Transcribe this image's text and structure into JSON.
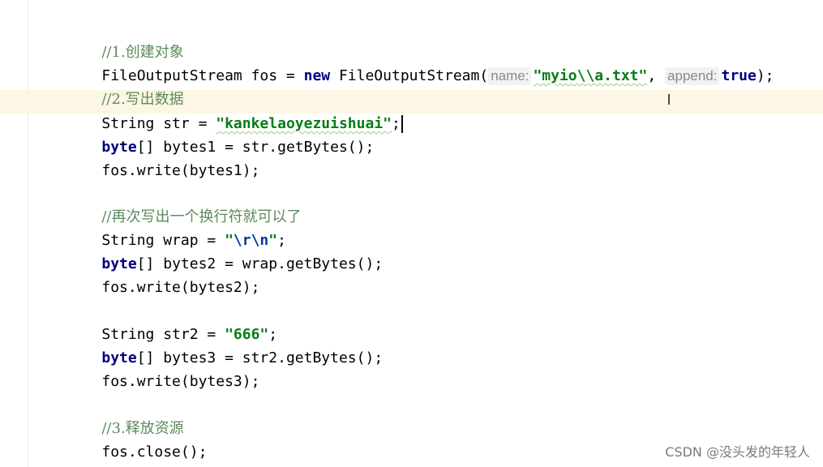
{
  "code": {
    "l1_comment": "//1.创建对象",
    "l2_type": "FileOutputStream fos = ",
    "l2_new": "new",
    "l2_ctor": " FileOutputStream(",
    "l2_hint_name": "name:",
    "l2_str": "\"myio\\\\a.txt\"",
    "l2_comma": ", ",
    "l2_hint_append": "append:",
    "l2_true": "true",
    "l2_end": ");",
    "l3_comment": "//2.写出数据",
    "l4_decl": "String str = ",
    "l4_str": "\"kankelaoyezuishuai\"",
    "l4_end": ";",
    "l5_byte": "byte",
    "l5_rest": "[] bytes1 = str.getBytes();",
    "l6": "fos.write(bytes1);",
    "l8_comment": "//再次写出一个换行符就可以了",
    "l9_decl": "String wrap = ",
    "l9_q1": "\"",
    "l9_esc": "\\r\\n",
    "l9_q2": "\"",
    "l9_end": ";",
    "l10_byte": "byte",
    "l10_rest": "[] bytes2 = wrap.getBytes();",
    "l11": "fos.write(bytes2);",
    "l13_decl": "String str2 = ",
    "l13_str": "\"666\"",
    "l13_end": ";",
    "l14_byte": "byte",
    "l14_rest": "[] bytes3 = str2.getBytes();",
    "l15": "fos.write(bytes3);",
    "l17_comment": "//3.释放资源",
    "l18": "fos.close();"
  },
  "cursor_icon": "I",
  "watermark": "CSDN @没头发的年轻人",
  "colors": {
    "comment": "#5b8a5b",
    "keyword": "#000080",
    "string": "#067d17",
    "escape": "#0037a6",
    "current_line": "#fcf6e4",
    "hint_bg": "#f2f2f2"
  }
}
